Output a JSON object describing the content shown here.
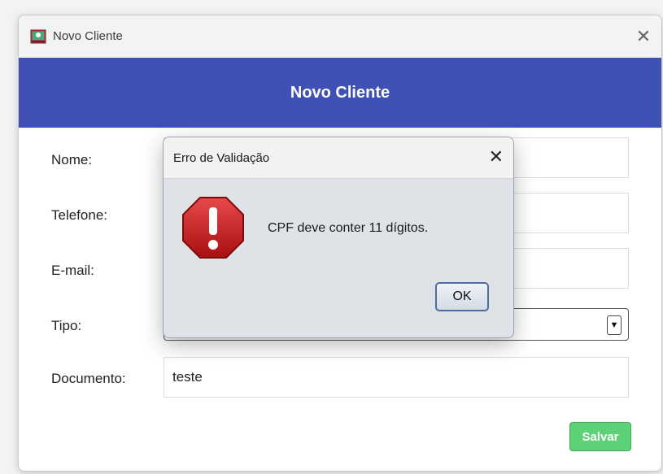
{
  "window": {
    "title": "Novo Cliente",
    "close_glyph": "✕",
    "icon": "app-icon"
  },
  "header": {
    "title": "Novo Cliente",
    "color": "#3f51b5"
  },
  "form": {
    "fields": [
      {
        "label": "Nome:",
        "value": ""
      },
      {
        "label": "Telefone:",
        "value": ""
      },
      {
        "label": "E-mail:",
        "value": ""
      },
      {
        "label": "Tipo:",
        "value": ""
      },
      {
        "label": "Documento:",
        "value": "teste"
      }
    ],
    "select_arrow": "▼",
    "save_label": "Salvar",
    "save_color": "#5cd175"
  },
  "dialog": {
    "title": "Erro de Validação",
    "close_glyph": "✕",
    "icon": "error-icon",
    "message": "CPF deve conter 11 dígitos.",
    "ok_label": "OK"
  }
}
